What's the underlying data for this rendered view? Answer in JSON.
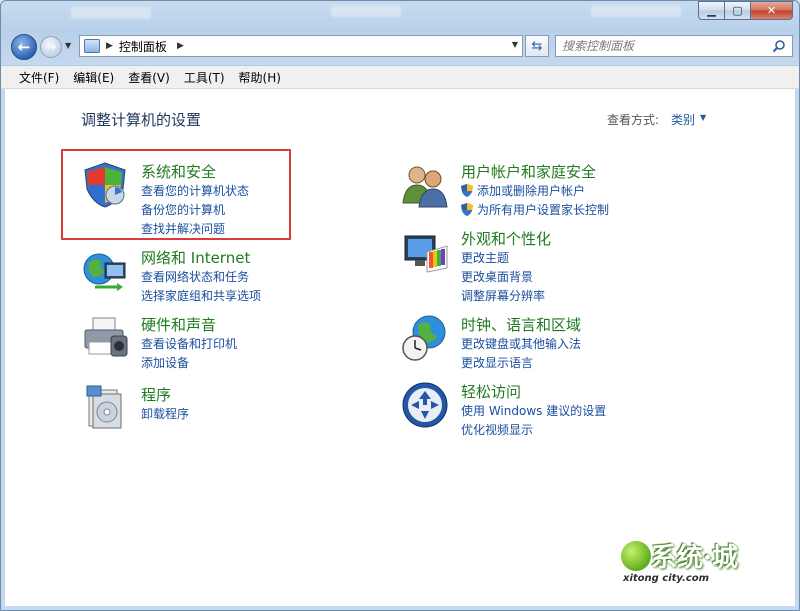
{
  "window": {
    "controls": {
      "minimize": "▁",
      "maximize": "▢",
      "close": "✕"
    }
  },
  "address_bar": {
    "breadcrumb": "控制面板",
    "search_placeholder": "搜索控制面板"
  },
  "menu": [
    "文件(F)",
    "编辑(E)",
    "查看(V)",
    "工具(T)",
    "帮助(H)"
  ],
  "main": {
    "title": "调整计算机的设置",
    "view_by_label": "查看方式:",
    "view_by_value": "类别"
  },
  "categories": [
    {
      "title": "系统和安全",
      "icon": "shield-icon",
      "links": [
        "查看您的计算机状态",
        "备份您的计算机",
        "查找并解决问题"
      ]
    },
    {
      "title": "网络和 Internet",
      "icon": "network-globe-icon",
      "links": [
        "查看网络状态和任务",
        "选择家庭组和共享选项"
      ]
    },
    {
      "title": "硬件和声音",
      "icon": "printer-icon",
      "links": [
        "查看设备和打印机",
        "添加设备"
      ]
    },
    {
      "title": "程序",
      "icon": "programs-icon",
      "links": [
        "卸载程序"
      ]
    },
    {
      "title": "用户帐户和家庭安全",
      "icon": "users-icon",
      "links": [
        "添加或删除用户帐户",
        "为所有用户设置家长控制"
      ]
    },
    {
      "title": "外观和个性化",
      "icon": "monitor-palette-icon",
      "links": [
        "更改主题",
        "更改桌面背景",
        "调整屏幕分辨率"
      ]
    },
    {
      "title": "时钟、语言和区域",
      "icon": "clock-globe-icon",
      "links": [
        "更改键盘或其他输入法",
        "更改显示语言"
      ]
    },
    {
      "title": "轻松访问",
      "icon": "ease-of-access-icon",
      "links": [
        "使用 Windows 建议的设置",
        "优化视频显示"
      ]
    }
  ],
  "watermark": {
    "main": "系统·城",
    "sub": "xitong city.com"
  },
  "colors": {
    "category_title": "#1f7a20",
    "link": "#1a4fa0",
    "highlight_box": "#d93a3a"
  }
}
